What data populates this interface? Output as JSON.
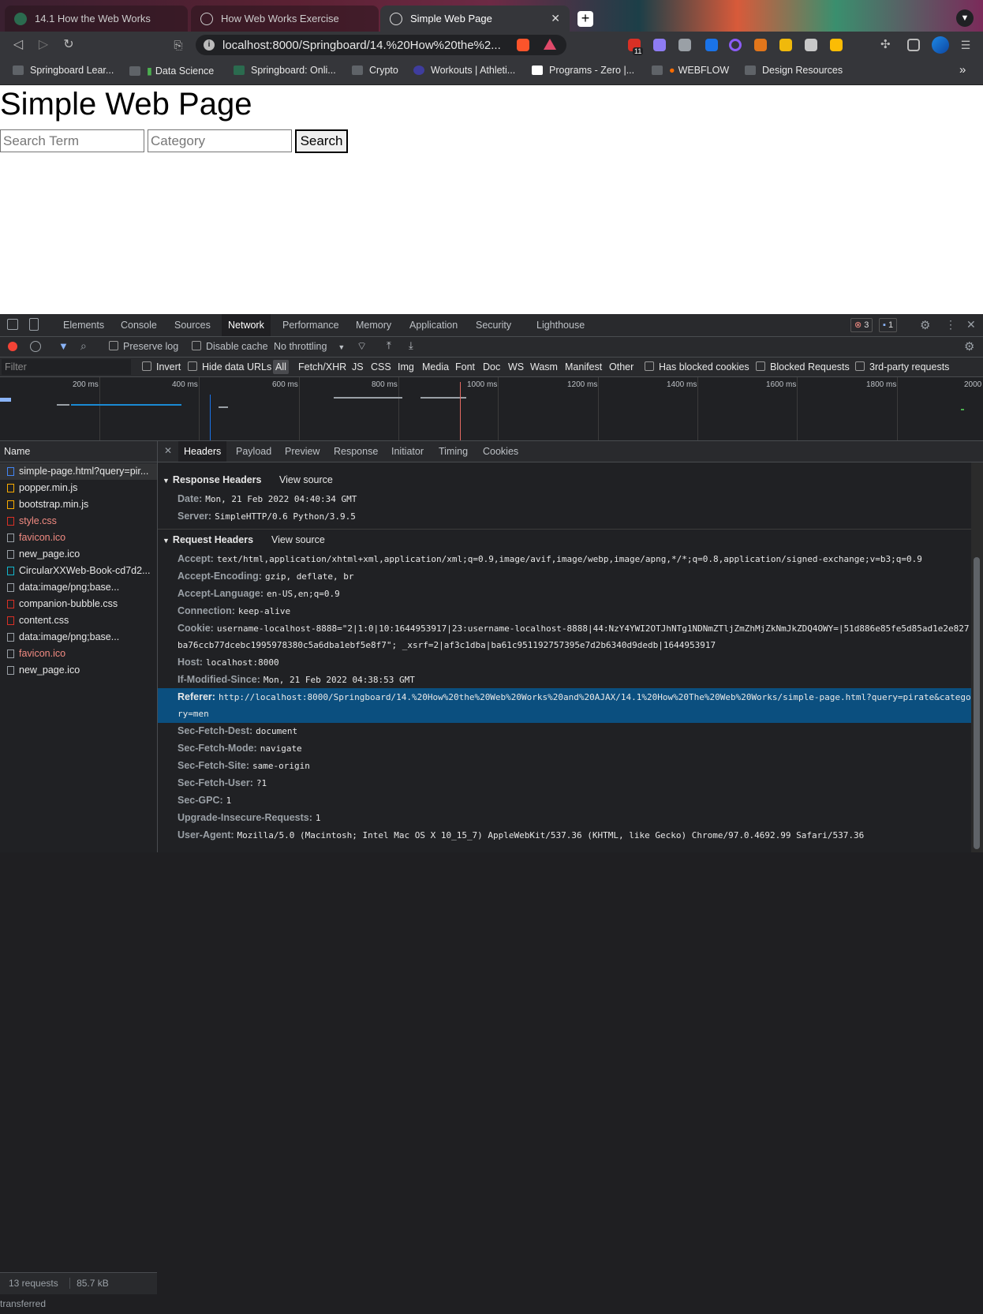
{
  "browser": {
    "tabs": [
      {
        "title": "14.1 How the Web Works",
        "active": false
      },
      {
        "title": "How Web Works Exercise",
        "active": false
      },
      {
        "title": "Simple Web Page",
        "active": true
      }
    ],
    "url": "localhost:8000/Springboard/14.%20How%20the%2...",
    "bookmarks": [
      "Springboard Lear...",
      "Data Science",
      "Springboard: Onli...",
      "Crypto",
      "Workouts | Athleti...",
      "Programs - Zero |...",
      "WEBFLOW",
      "Design Resources"
    ],
    "extension_badge": "11"
  },
  "page": {
    "title": "Simple Web Page",
    "search_placeholder": "Search Term",
    "category_placeholder": "Category",
    "search_button": "Search"
  },
  "devtools": {
    "tabs": [
      "Elements",
      "Console",
      "Sources",
      "Network",
      "Performance",
      "Memory",
      "Application",
      "Security",
      "Lighthouse"
    ],
    "active_tab": "Network",
    "error_count": "3",
    "message_count": "1",
    "toolbar": {
      "preserve_log": "Preserve log",
      "disable_cache": "Disable cache",
      "throttling": "No throttling"
    },
    "filter": {
      "placeholder": "Filter",
      "invert": "Invert",
      "hide_data_urls": "Hide data URLs",
      "types": [
        "All",
        "Fetch/XHR",
        "JS",
        "CSS",
        "Img",
        "Media",
        "Font",
        "Doc",
        "WS",
        "Wasm",
        "Manifest",
        "Other"
      ],
      "has_blocked_cookies": "Has blocked cookies",
      "blocked_requests": "Blocked Requests",
      "third_party": "3rd-party requests"
    },
    "timeline_labels": [
      "200 ms",
      "400 ms",
      "600 ms",
      "800 ms",
      "1000 ms",
      "1200 ms",
      "1400 ms",
      "1600 ms",
      "1800 ms",
      "2000"
    ],
    "list_header": "Name",
    "requests": [
      {
        "name": "simple-page.html?query=pir...",
        "error": false
      },
      {
        "name": "popper.min.js",
        "error": false
      },
      {
        "name": "bootstrap.min.js",
        "error": false
      },
      {
        "name": "style.css",
        "error": true
      },
      {
        "name": "favicon.ico",
        "error": true
      },
      {
        "name": "new_page.ico",
        "error": false
      },
      {
        "name": "CircularXXWeb-Book-cd7d2...",
        "error": false
      },
      {
        "name": "data:image/png;base...",
        "error": false
      },
      {
        "name": "companion-bubble.css",
        "error": false
      },
      {
        "name": "content.css",
        "error": false
      },
      {
        "name": "data:image/png;base...",
        "error": false
      },
      {
        "name": "favicon.ico",
        "error": true
      },
      {
        "name": "new_page.ico",
        "error": false
      }
    ],
    "footer": {
      "requests": "13 requests",
      "transferred": "85.7 kB transferred"
    },
    "detail_tabs": [
      "Headers",
      "Payload",
      "Preview",
      "Response",
      "Initiator",
      "Timing",
      "Cookies"
    ],
    "active_detail_tab": "Headers",
    "response_headers_title": "Response Headers",
    "request_headers_title": "Request Headers",
    "view_source": "View source",
    "response_headers": [
      {
        "key": "Date:",
        "value": "Mon, 21 Feb 2022 04:40:34 GMT"
      },
      {
        "key": "Server:",
        "value": "SimpleHTTP/0.6 Python/3.9.5"
      }
    ],
    "request_headers": [
      {
        "key": "Accept:",
        "value": "text/html,application/xhtml+xml,application/xml;q=0.9,image/avif,image/webp,image/apng,*/*;q=0.8,application/signed-exchange;v=b3;q=0.9"
      },
      {
        "key": "Accept-Encoding:",
        "value": "gzip, deflate, br"
      },
      {
        "key": "Accept-Language:",
        "value": "en-US,en;q=0.9"
      },
      {
        "key": "Connection:",
        "value": "keep-alive"
      },
      {
        "key": "Cookie:",
        "value": "username-localhost-8888=\"2|1:0|10:1644953917|23:username-localhost-8888|44:NzY4YWI2OTJhNTg1NDNmZTljZmZhMjZkNmJkZDQ4OWY=|51d886e85fe5d85ad1e2e827",
        "value2": "ba76ccb77dcebc1995978380c5a6dba1ebf5e8f7\"; _xsrf=2|af3c1dba|ba61c951192757395e7d2b6340d9dedb|1644953917"
      },
      {
        "key": "Host:",
        "value": "localhost:8000"
      },
      {
        "key": "If-Modified-Since:",
        "value": "Mon, 21 Feb 2022 04:38:53 GMT"
      },
      {
        "key": "Referer:",
        "value": "http://localhost:8000/Springboard/14.%20How%20the%20Web%20Works%20and%20AJAX/14.1%20How%20The%20Web%20Works/simple-page.html?query=pirate&catego",
        "value2": "ry=men"
      },
      {
        "key": "Sec-Fetch-Dest:",
        "value": "document"
      },
      {
        "key": "Sec-Fetch-Mode:",
        "value": "navigate"
      },
      {
        "key": "Sec-Fetch-Site:",
        "value": "same-origin"
      },
      {
        "key": "Sec-Fetch-User:",
        "value": "?1"
      },
      {
        "key": "Sec-GPC:",
        "value": "1"
      },
      {
        "key": "Upgrade-Insecure-Requests:",
        "value": "1"
      },
      {
        "key": "User-Agent:",
        "value": "Mozilla/5.0 (Macintosh; Intel Mac OS X 10_15_7) AppleWebKit/537.36 (KHTML, like Gecko) Chrome/97.0.4692.99 Safari/537.36"
      }
    ]
  }
}
